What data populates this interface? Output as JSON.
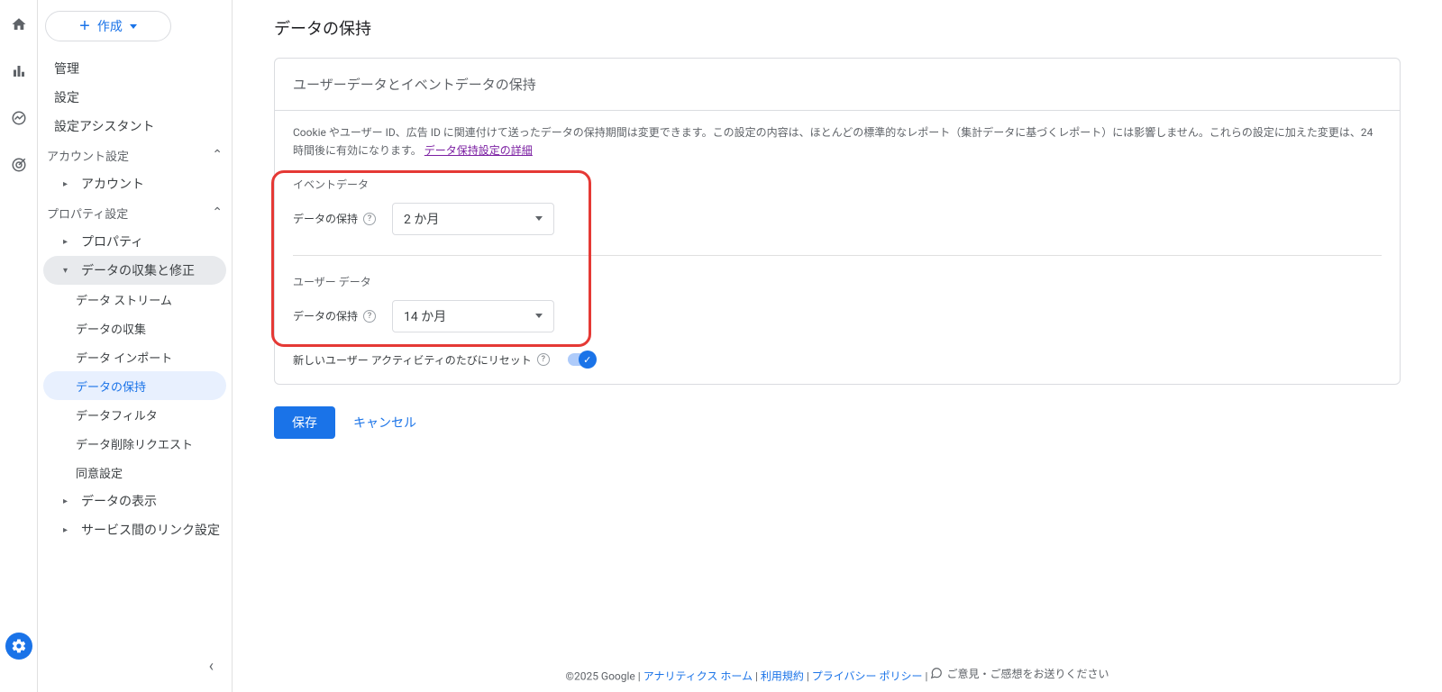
{
  "rail": {
    "icons": [
      "home",
      "bar-chart",
      "line-chart",
      "target",
      "gear"
    ]
  },
  "sidebar": {
    "create_label": "作成",
    "items_top": [
      "管理",
      "設定",
      "設定アシスタント"
    ],
    "section_account": "アカウント設定",
    "sub_account": "アカウント",
    "section_property": "プロパティ設定",
    "sub_property": "プロパティ",
    "sub_data_collect": "データの収集と修正",
    "leaves": [
      "データ ストリーム",
      "データの収集",
      "データ インポート",
      "データの保持",
      "データフィルタ",
      "データ削除リクエスト",
      "同意設定"
    ],
    "sub_data_display": "データの表示",
    "sub_service_link": "サービス間のリンク設定"
  },
  "page": {
    "title": "データの保持",
    "card_title": "ユーザーデータとイベントデータの保持",
    "desc_a": "Cookie やユーザー ID、広告 ID に関連付けて送ったデータの保持期間は変更できます。この設定の内容は、ほとんどの標準的なレポート（集計データに基づくレポート）には影響しません。これらの設定に加えた変更は、24 時間後に有効になります。",
    "desc_link": "データ保持設定の詳細",
    "event_data": "イベントデータ",
    "user_data": "ユーザー データ",
    "retention_label": "データの保持",
    "event_value": "2 か月",
    "user_value": "14 か月",
    "reset_label": "新しいユーザー アクティビティのたびにリセット",
    "save": "保存",
    "cancel": "キャンセル"
  },
  "footer": {
    "copyright": "©2025 Google",
    "home": "アナリティクス ホーム",
    "terms": "利用規約",
    "privacy": "プライバシー ポリシー",
    "feedback": "ご意見・ご感想をお送りください"
  }
}
